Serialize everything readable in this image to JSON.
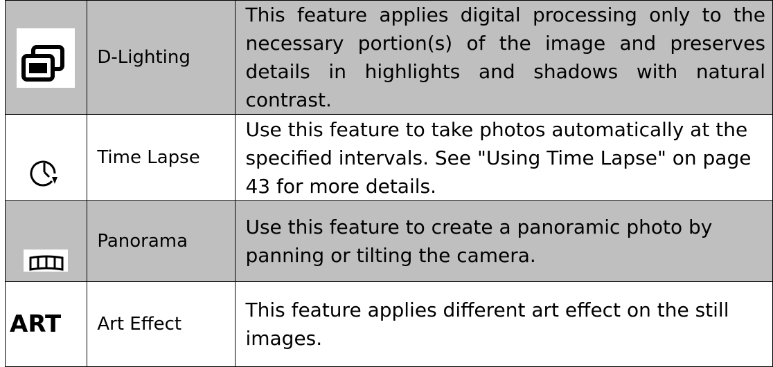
{
  "colors": {
    "shaded_row": "#bfbfbf",
    "icon_bg": "#ffffff",
    "border": "#000000",
    "text": "#000000"
  },
  "rows": [
    {
      "icon": "d-lighting-icon",
      "name": "D-Lighting",
      "description": "This feature applies digital processing only to the necessary portion(s) of the image and preserves details in highlights and shadows with natural contrast.",
      "shaded": true
    },
    {
      "icon": "time-lapse-icon",
      "name": "Time Lapse",
      "description": "Use this feature to take photos automatically at the specified intervals. See \"Using Time Lapse\" on page 43 for more details.",
      "shaded": false
    },
    {
      "icon": "panorama-icon",
      "name": "Panorama",
      "description": "Use this feature to create a panoramic photo by panning or tilting the camera.",
      "shaded": true
    },
    {
      "icon": "art-effect-icon",
      "icon_text": "ART",
      "name": "Art Effect",
      "description": "This feature applies different art effect on the still images.",
      "shaded": false
    }
  ]
}
